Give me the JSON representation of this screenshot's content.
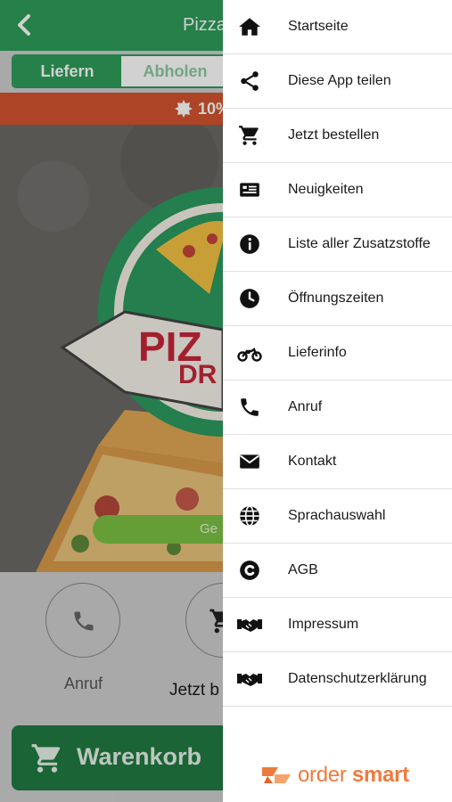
{
  "app": {
    "title": "Pizza",
    "tabs": [
      "Liefern",
      "Abholen"
    ],
    "promo_text": "10%",
    "open_button": "Ge",
    "actions": [
      {
        "label": "Anruf",
        "icon": "phone-icon"
      },
      {
        "label": "Jetzt b",
        "icon": "cart-icon"
      }
    ],
    "cart_button": "Warenkorb",
    "colors": {
      "brand_green": "#2e9d5a",
      "promo_red": "#d4542e",
      "cart_green": "#207a43",
      "accent_orange": "#f07a3c"
    }
  },
  "drawer": {
    "items": [
      {
        "label": "Startseite",
        "icon": "home-icon"
      },
      {
        "label": "Diese App teilen",
        "icon": "share-icon"
      },
      {
        "label": "Jetzt bestellen",
        "icon": "cart-icon"
      },
      {
        "label": "Neuigkeiten",
        "icon": "news-icon"
      },
      {
        "label": "Liste aller Zusatzstoffe",
        "icon": "info-icon"
      },
      {
        "label": "Öffnungszeiten",
        "icon": "clock-icon"
      },
      {
        "label": "Lieferinfo",
        "icon": "motorcycle-icon"
      },
      {
        "label": "Anruf",
        "icon": "phone-icon"
      },
      {
        "label": "Kontakt",
        "icon": "envelope-icon"
      },
      {
        "label": "Sprachauswahl",
        "icon": "globe-icon"
      },
      {
        "label": "AGB",
        "icon": "copyright-icon"
      },
      {
        "label": "Impressum",
        "icon": "handshake-icon"
      },
      {
        "label": "Datenschutzerklärung",
        "icon": "handshake-icon"
      }
    ],
    "brand": {
      "word1": "order",
      "word2": "smart"
    }
  }
}
